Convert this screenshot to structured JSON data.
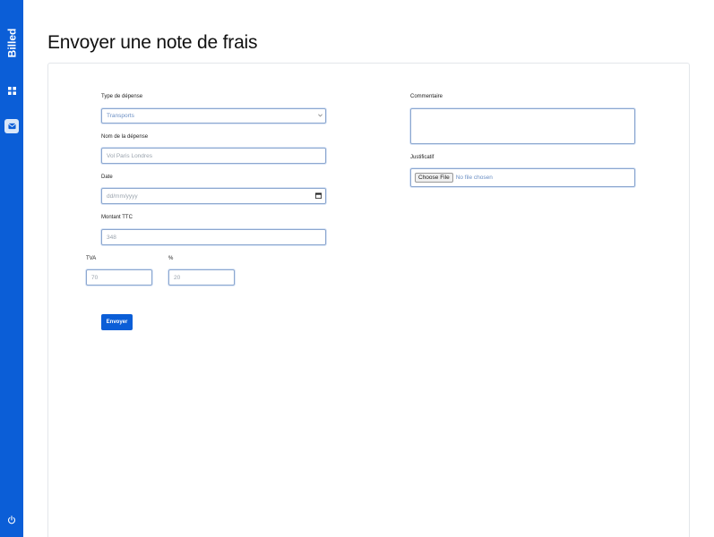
{
  "sidebar": {
    "brand": "Billed",
    "items": [
      {
        "icon": "window-icon",
        "active": false
      },
      {
        "icon": "mail-icon",
        "active": true
      }
    ],
    "logout_icon": "power-icon"
  },
  "page": {
    "title": "Envoyer une note de frais"
  },
  "form": {
    "expense_type": {
      "label": "Type de dépense",
      "value": "Transports"
    },
    "expense_name": {
      "label": "Nom de la dépense",
      "placeholder": "Vol Paris Londres"
    },
    "date": {
      "label": "Date",
      "placeholder": "dd/mm/yyyy"
    },
    "amount": {
      "label": "Montant TTC",
      "placeholder": "348"
    },
    "vat": {
      "label": "TVA",
      "placeholder": "70"
    },
    "pct": {
      "label": "%",
      "placeholder": "20"
    },
    "comment": {
      "label": "Commentaire",
      "value": ""
    },
    "file": {
      "label": "Justificatif",
      "button": "Choose File",
      "status": "No file chosen"
    },
    "submit": "Envoyer"
  },
  "colors": {
    "accent": "#0b5ed7",
    "field_border": "#8ca7cf",
    "placeholder": "#9aa3ad"
  }
}
